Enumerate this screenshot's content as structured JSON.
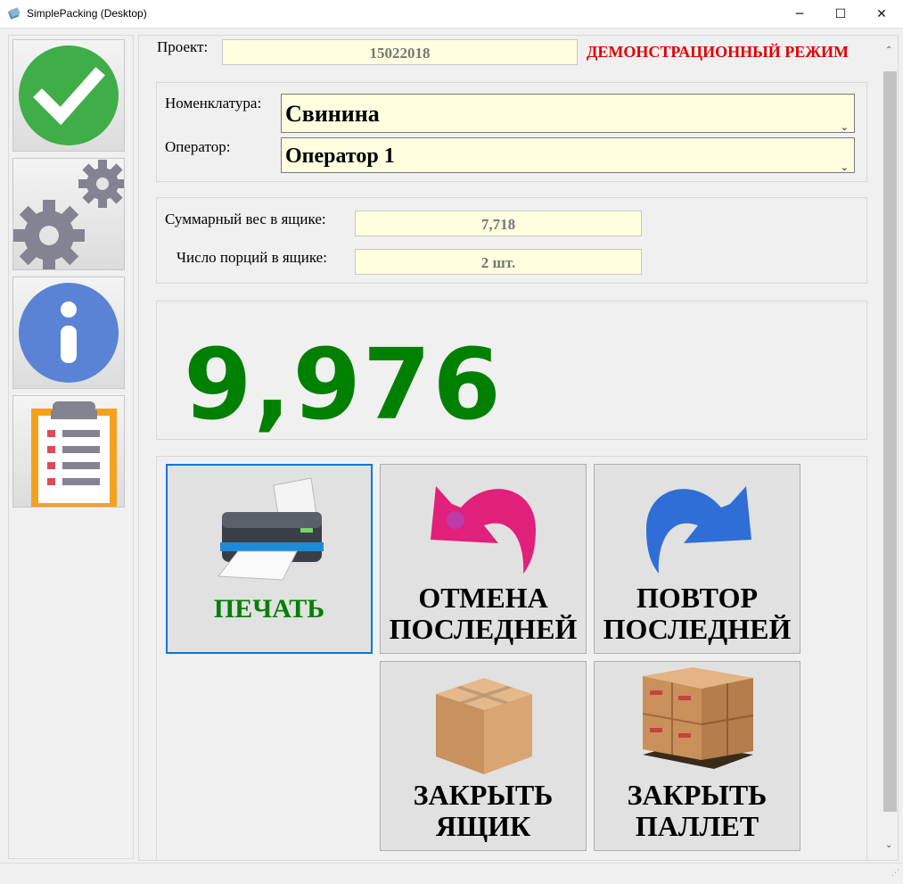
{
  "window": {
    "title": "SimplePacking (Desktop)",
    "minimize": "─",
    "maximize": "☐",
    "close": "✕"
  },
  "sidebar": {
    "items": [
      {
        "name": "confirm",
        "icon": "checkmark-icon"
      },
      {
        "name": "settings",
        "icon": "gears-icon"
      },
      {
        "name": "info",
        "icon": "info-icon"
      },
      {
        "name": "report",
        "icon": "clipboard-icon"
      }
    ]
  },
  "project": {
    "label": "Проект:",
    "value": "15022018",
    "mode": "ДЕМОНСТРАЦИОННЫЙ РЕЖИМ"
  },
  "selection": {
    "nomenclature_label": "Номенклатура:",
    "nomenclature_value": "Свинина",
    "operator_label": "Оператор:",
    "operator_value": "Оператор 1"
  },
  "box": {
    "total_weight_label": "Суммарный вес в ящике:",
    "total_weight_value": "7,718",
    "portions_label": "Число порций в ящике:",
    "portions_value": "2 шт."
  },
  "scale": {
    "weight": "9,976"
  },
  "actions": {
    "print": {
      "label": "ПЕЧАТЬ",
      "icon": "printer-icon"
    },
    "undo": {
      "label_line1": "ОТМЕНА",
      "label_line2": "ПОСЛЕДНЕЙ",
      "icon": "undo-arrow-icon"
    },
    "redo": {
      "label_line1": "ПОВТОР",
      "label_line2": "ПОСЛЕДНЕЙ",
      "icon": "redo-arrow-icon"
    },
    "close_box": {
      "label_line1": "ЗАКРЫТЬ",
      "label_line2": "ЯЩИК",
      "icon": "box-icon"
    },
    "close_pallet": {
      "label_line1": "ЗАКРЫТЬ",
      "label_line2": "ПАЛЛЕТ",
      "icon": "pallet-icon"
    }
  },
  "colors": {
    "accent_green": "#008000",
    "demo_red": "#e00000",
    "field_bg": "#ffffe0",
    "focus_blue": "#0078d7"
  }
}
